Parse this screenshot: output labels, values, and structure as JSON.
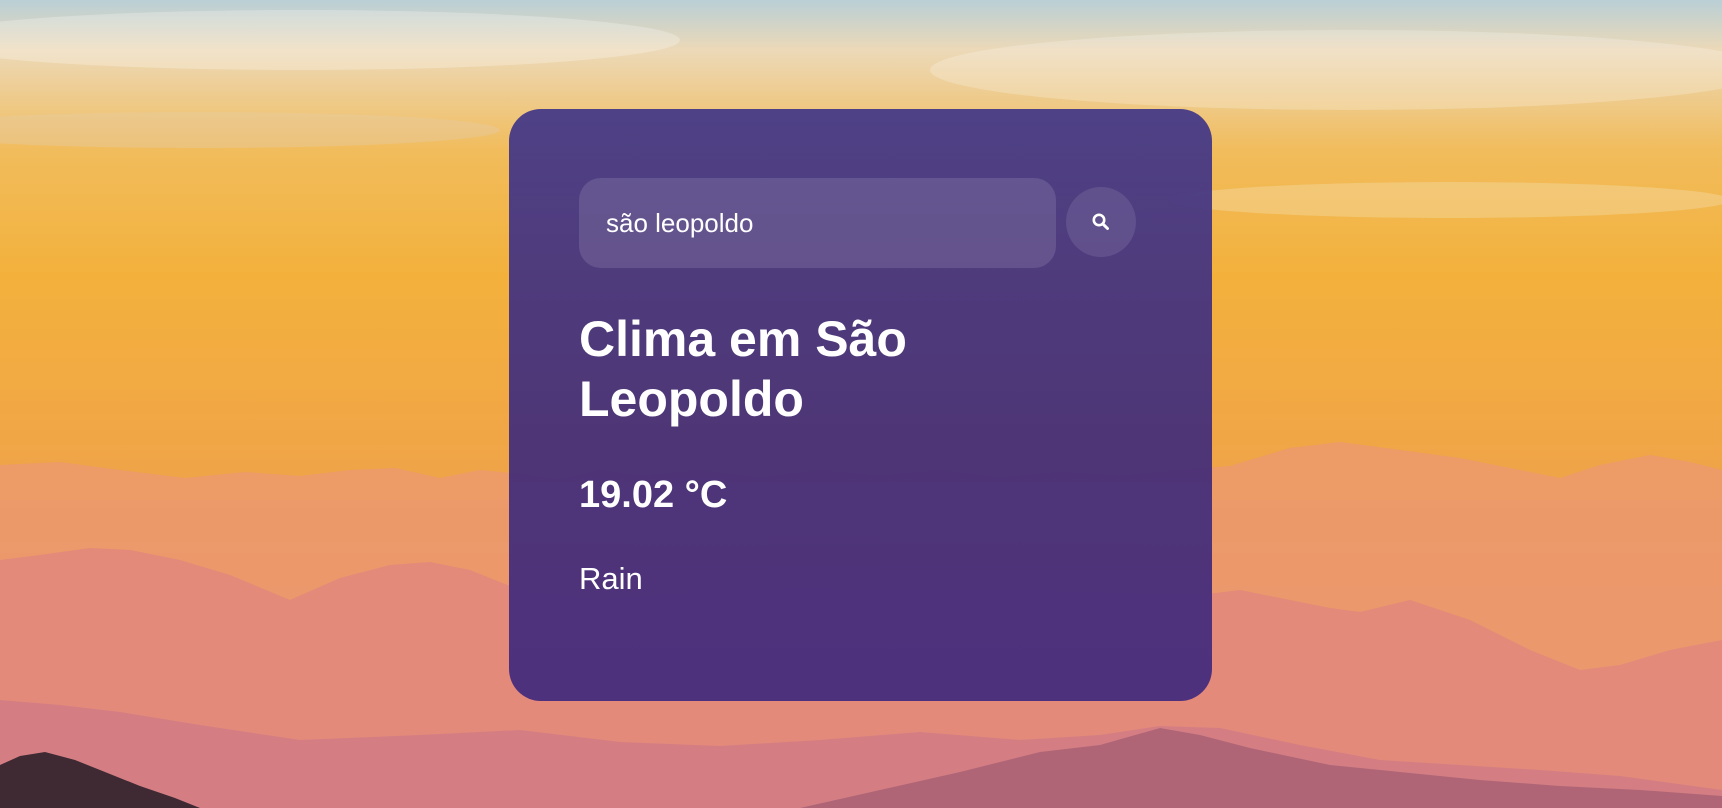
{
  "search": {
    "value": "são leopoldo",
    "button_icon": "search-icon"
  },
  "weather": {
    "title": "Clima em São Leopoldo",
    "temperature": "19.02 °C",
    "description": "Rain"
  },
  "colors": {
    "card": "#45307a",
    "text": "#ffffff"
  }
}
